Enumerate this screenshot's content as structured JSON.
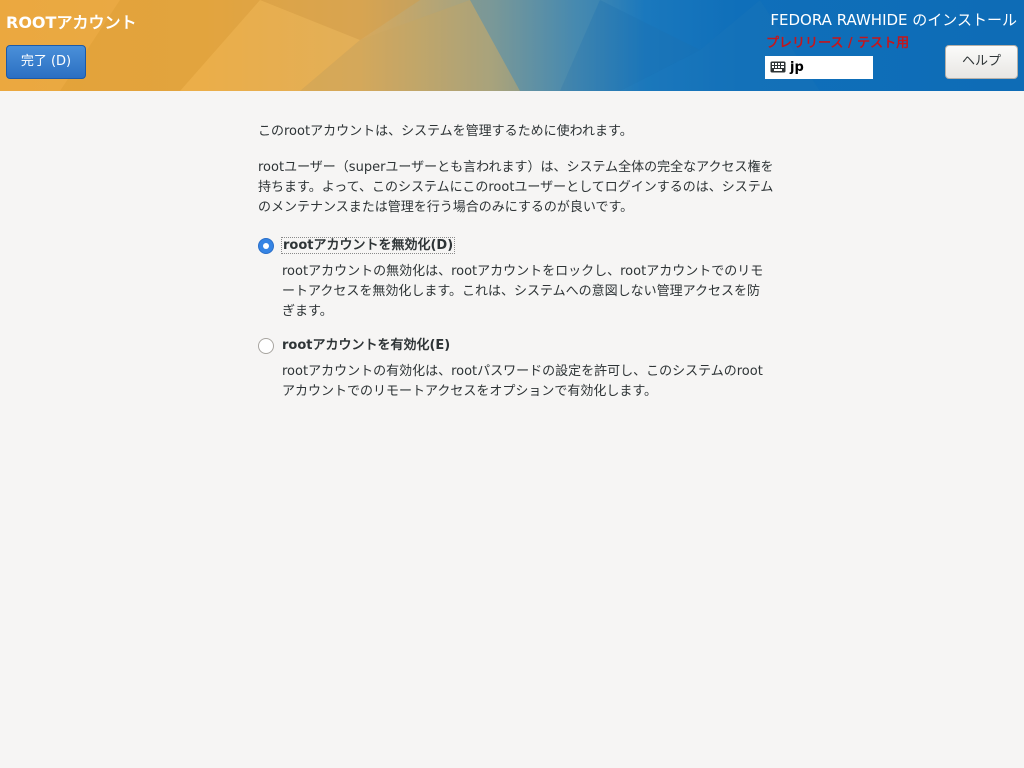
{
  "header": {
    "page_title": "ROOTアカウント",
    "done_label": "完了 (D)",
    "product_title": "FEDORA RAWHIDE のインストール",
    "prerelease_label": "プレリリース / テスト用",
    "keyboard_layout": "jp",
    "help_label": "ヘルプ"
  },
  "content": {
    "intro": "このrootアカウントは、システムを管理するために使われます。",
    "description": "rootユーザー（superユーザーとも言われます）は、システム全体の完全なアクセス権を持ちます。よって、このシステムにこのrootユーザーとしてログインするのは、システムのメンテナンスまたは管理を行う場合のみにするのが良いです。",
    "options": [
      {
        "label": "rootアカウントを無効化(D)",
        "description": "rootアカウントの無効化は、rootアカウントをロックし、rootアカウントでのリモートアクセスを無効化します。これは、システムへの意図しない管理アクセスを防ぎます。",
        "selected": true
      },
      {
        "label": "rootアカウントを有効化(E)",
        "description": "rootアカウントの有効化は、rootパスワードの設定を許可し、このシステムのrootアカウントでのリモートアクセスをオプションで有効化します。",
        "selected": false
      }
    ]
  },
  "colors": {
    "accent": "#3584e4",
    "prerelease": "#c4161c",
    "done_button": "#2b6fc2"
  },
  "icons": {
    "keyboard": "keyboard-icon"
  }
}
